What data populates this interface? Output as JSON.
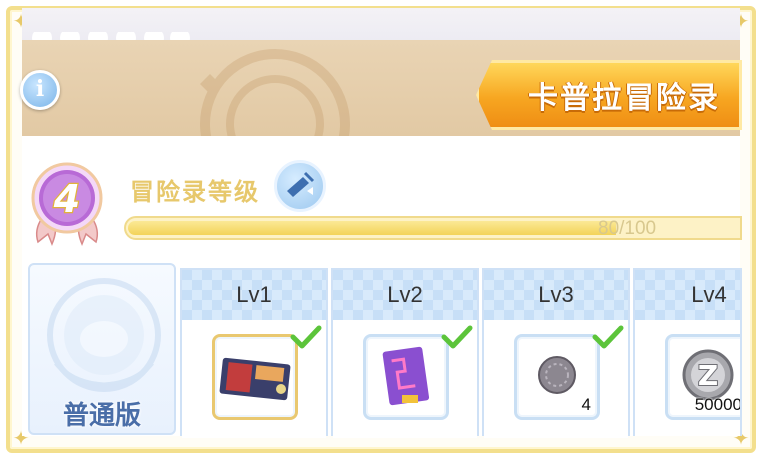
{
  "header": {
    "title": "卡普拉冒险录"
  },
  "info_button": {
    "icon": "info-icon",
    "label": "i"
  },
  "level": {
    "value": "4",
    "label": "冒险录等级",
    "progress_text": "80/100",
    "progress_current": 80,
    "progress_max": 100
  },
  "version": {
    "label": "普通版"
  },
  "rewards": [
    {
      "label": "Lv1",
      "item": "card-item-icon",
      "claimed": true,
      "quantity": ""
    },
    {
      "label": "Lv2",
      "item": "purple-card-icon",
      "claimed": true,
      "quantity": ""
    },
    {
      "label": "Lv3",
      "item": "coin-icon",
      "claimed": true,
      "quantity": "4"
    },
    {
      "label": "Lv4",
      "item": "zeny-icon",
      "claimed": false,
      "quantity": "50000"
    }
  ],
  "colors": {
    "accent_orange": "#f7a621",
    "banner_tan": "#e6cfac",
    "check_green": "#5cc43a",
    "badge_purple": "#b86ad6",
    "progress_yellow": "#f3d359"
  }
}
